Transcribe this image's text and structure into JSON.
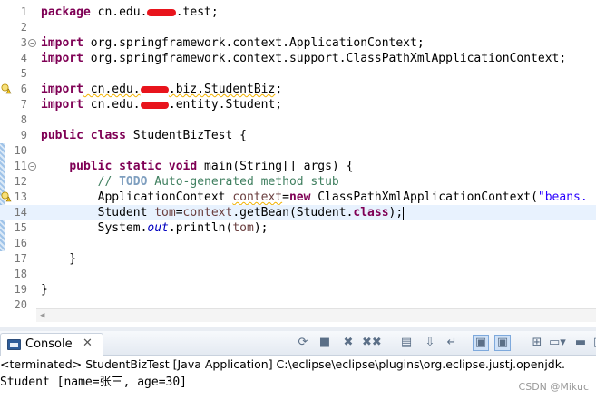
{
  "editor": {
    "lines": [
      {
        "num": "1",
        "parts": [
          {
            "t": "package",
            "c": "kw"
          },
          {
            "t": " cn.edu."
          },
          {
            "t": "xxxx",
            "c": "redact"
          },
          {
            "t": ".test;"
          }
        ]
      },
      {
        "num": "2",
        "parts": []
      },
      {
        "num": "3",
        "fold": "minus",
        "parts": [
          {
            "t": "import",
            "c": "kw"
          },
          {
            "t": " org.springframework.context.ApplicationContext;"
          }
        ]
      },
      {
        "num": "4",
        "parts": [
          {
            "t": "import",
            "c": "kw"
          },
          {
            "t": " org.springframework.context.support.ClassPathXmlApplicationContext;"
          }
        ]
      },
      {
        "num": "5",
        "parts": []
      },
      {
        "num": "6",
        "warn": true,
        "parts": [
          {
            "t": "import",
            "c": "kw"
          },
          {
            "t": " cn.edu.",
            "c": "warn-ul"
          },
          {
            "t": "xxxx",
            "c": "redact"
          },
          {
            "t": ".biz.StudentBiz",
            "c": "warn-ul"
          },
          {
            "t": ";"
          }
        ]
      },
      {
        "num": "7",
        "parts": [
          {
            "t": "import",
            "c": "kw"
          },
          {
            "t": " cn.edu."
          },
          {
            "t": "xxxx",
            "c": "redact"
          },
          {
            "t": ".entity.Student;"
          }
        ]
      },
      {
        "num": "8",
        "parts": []
      },
      {
        "num": "9",
        "parts": [
          {
            "t": "public",
            "c": "kw"
          },
          {
            "t": " "
          },
          {
            "t": "class",
            "c": "kw"
          },
          {
            "t": " StudentBizTest {"
          }
        ]
      },
      {
        "num": "10",
        "ruler": true,
        "parts": []
      },
      {
        "num": "11",
        "ruler": true,
        "fold": "minus",
        "parts": [
          {
            "t": "    "
          },
          {
            "t": "public",
            "c": "kw"
          },
          {
            "t": " "
          },
          {
            "t": "static",
            "c": "kw"
          },
          {
            "t": " "
          },
          {
            "t": "void",
            "c": "kw"
          },
          {
            "t": " main(String[] args) {"
          }
        ]
      },
      {
        "num": "12",
        "ruler": true,
        "parts": [
          {
            "t": "        "
          },
          {
            "t": "// ",
            "c": "cmt"
          },
          {
            "t": "TODO",
            "c": "todo"
          },
          {
            "t": " Auto-generated method stub",
            "c": "cmt"
          }
        ]
      },
      {
        "num": "13",
        "ruler": true,
        "warn": true,
        "parts": [
          {
            "t": "        ApplicationContext "
          },
          {
            "t": "context",
            "c": "var warn-ul"
          },
          {
            "t": "="
          },
          {
            "t": "new",
            "c": "kw"
          },
          {
            "t": " ClassPathXmlApplicationContext("
          },
          {
            "t": "\"beans.",
            "c": "str"
          }
        ]
      },
      {
        "num": "14",
        "ruler": true,
        "current": true,
        "parts": [
          {
            "t": "        Student "
          },
          {
            "t": "tom",
            "c": "var"
          },
          {
            "t": "="
          },
          {
            "t": "context",
            "c": "var"
          },
          {
            "t": ".getBean(Student."
          },
          {
            "t": "class",
            "c": "kw"
          },
          {
            "t": ");"
          }
        ],
        "caret": true
      },
      {
        "num": "15",
        "ruler": true,
        "parts": [
          {
            "t": "        System."
          },
          {
            "t": "out",
            "c": "fld"
          },
          {
            "t": ".println("
          },
          {
            "t": "tom",
            "c": "var"
          },
          {
            "t": ");"
          }
        ]
      },
      {
        "num": "16",
        "ruler": true,
        "parts": []
      },
      {
        "num": "17",
        "parts": [
          {
            "t": "    }"
          }
        ]
      },
      {
        "num": "18",
        "parts": []
      },
      {
        "num": "19",
        "parts": [
          {
            "t": "}"
          }
        ]
      },
      {
        "num": "20",
        "parts": []
      }
    ]
  },
  "console": {
    "tab_label": "Console",
    "close_glyph": "✕",
    "terminated_text": "<terminated> StudentBizTest [Java Application] C:\\eclipse\\eclipse\\plugins\\org.eclipse.justj.openjdk.",
    "output_text": "Student [name=张三, age=30]",
    "toolbar": [
      {
        "name": "terminate-relaunch-icon",
        "glyph": "⟳"
      },
      {
        "name": "terminate-icon",
        "glyph": "■"
      },
      {
        "name": "remove-launch-icon",
        "glyph": "✖"
      },
      {
        "name": "remove-all-terminated-icon",
        "glyph": "✖✖"
      },
      {
        "name": "clear-console-icon",
        "glyph": "▤"
      },
      {
        "name": "scroll-lock-icon",
        "glyph": "⇩"
      },
      {
        "name": "word-wrap-icon",
        "glyph": "↵"
      },
      {
        "name": "show-on-stdout-icon",
        "glyph": "▣",
        "pressed": true
      },
      {
        "name": "show-on-stderr-icon",
        "glyph": "▣",
        "pressed": true
      },
      {
        "name": "pin-console-icon",
        "glyph": "⊞"
      },
      {
        "name": "display-console-icon",
        "glyph": "▭▾"
      },
      {
        "name": "minimize-icon",
        "glyph": "▬"
      },
      {
        "name": "maximize-icon",
        "glyph": "□"
      }
    ]
  },
  "watermark": "CSDN @Mikuc"
}
